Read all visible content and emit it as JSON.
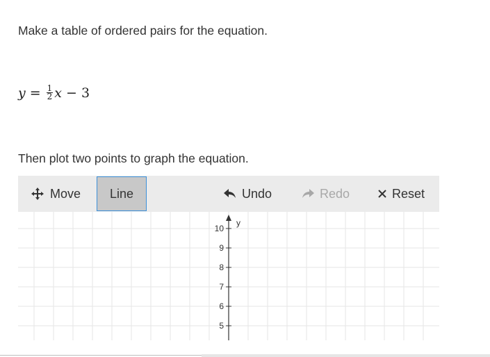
{
  "question": {
    "prompt": "Make a table of ordered pairs for the equation.",
    "equation": {
      "lhs": "y",
      "equals": "=",
      "frac_num": "1",
      "frac_den": "2",
      "var": "x",
      "rest": "− 3"
    },
    "instruction": "Then plot two points to graph the equation."
  },
  "toolbar": {
    "move_label": "Move",
    "line_label": "Line",
    "undo_label": "Undo",
    "redo_label": "Redo",
    "reset_label": "Reset",
    "active_tool": "Line",
    "redo_enabled": false,
    "icons": {
      "move": "move-arrows-icon",
      "undo": "undo-arrow-icon",
      "redo": "redo-arrow-icon",
      "reset": "close-x-icon"
    }
  },
  "graph": {
    "y_axis_label": "y",
    "y_ticks": [
      "10",
      "9",
      "8",
      "7",
      "6",
      "5"
    ],
    "grid_color": "#e6e6e6",
    "axis_color": "#333333"
  },
  "colors": {
    "toolbar_bg": "#ebebeb",
    "active_tool_bg": "#c8c8c8",
    "active_tool_border": "#3b8fd9",
    "disabled_text": "#a8a8a8"
  }
}
